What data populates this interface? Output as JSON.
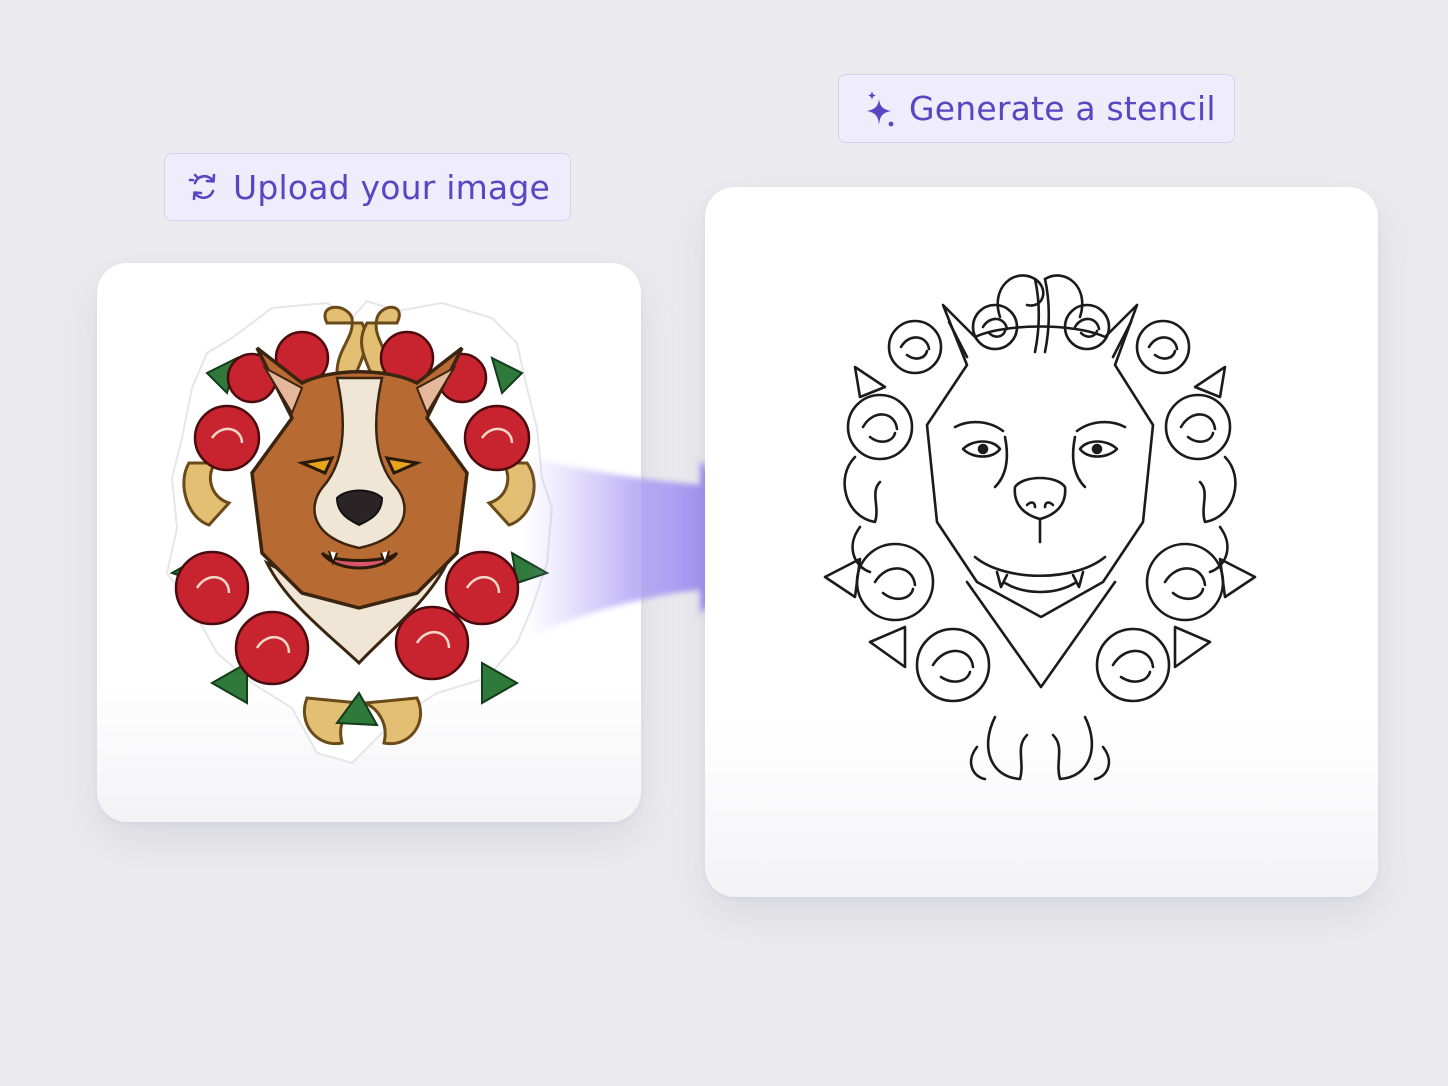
{
  "steps": {
    "upload": {
      "label": "Upload your image",
      "icon": "refresh-cycle-icon"
    },
    "generate": {
      "label": "Generate a stencil",
      "icon": "sparkles-icon"
    }
  },
  "images": {
    "source": "colored-dog-with-roses-illustration",
    "result": "line-art-dog-stencil"
  },
  "colors": {
    "accent": "#5a45c2",
    "pill_bg": "#efedfb",
    "pill_border": "#d6d0f1",
    "background": "#ebebef",
    "arrow": "#8f7bf0"
  }
}
